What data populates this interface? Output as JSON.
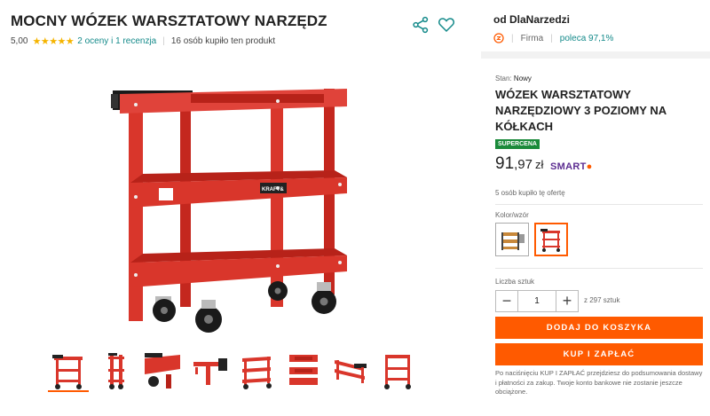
{
  "product": {
    "title": "MOCNY WÓZEK WARSZTATOWY NARZĘDZ",
    "rating": "5,00",
    "stars": "★★★★★",
    "reviews_link": "2 oceny i 1 recenzja",
    "bought_count": "16 osób kupiło ten produkt"
  },
  "gallery": {
    "thumbnails": [
      "wozek-front",
      "wozek-side",
      "wozek-shelf-detail",
      "wozek-handle",
      "wozek-angle",
      "wozek-top",
      "wozek-tilt",
      "wozek-back"
    ]
  },
  "seller": {
    "name": "od DlaNarzedzi",
    "type": "Firma",
    "recommend": "poleca 97,1%"
  },
  "offer": {
    "condition_label": "Stan:",
    "condition_value": "Nowy",
    "title": "WÓZEK WARSZTATOWY NARZĘDZIOWY 3 POZIOMY NA KÓŁKACH",
    "badge": "SUPERCENA",
    "price_main": "91",
    "price_fraction": ",97",
    "currency": "zł",
    "smart_label": "SMART",
    "bought_offer": "5 osób kupiło tę ofertę",
    "variant_label": "Kolor/wzór",
    "quantity_label": "Liczba sztuk",
    "quantity_value": "1",
    "quantity_available": "z 297 sztuk",
    "add_to_cart": "DODAJ DO KOSZYKA",
    "buy_now": "KUP I ZAPŁAĆ",
    "note": "Po naciśnięciu KUP I ZAPŁAĆ przejdziesz do podsumowania dostawy i płatności za zakup. Twoje konto bankowe nie zostanie jeszcze obciążone."
  },
  "colors": {
    "accent": "#ff5a00",
    "cart_red": "#d9362b",
    "link": "#148a8a",
    "badge": "#1a8a3a",
    "smart": "#5c2d91"
  }
}
